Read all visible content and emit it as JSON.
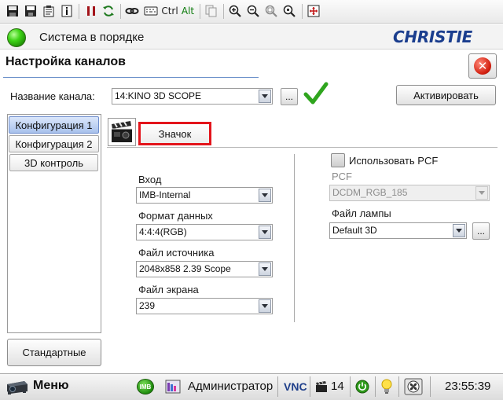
{
  "toolbar": {
    "icons": [
      "save-all-icon",
      "save-icon",
      "properties-icon",
      "info-icon",
      "pause-icon",
      "refresh-icon",
      "link-icon",
      "keyboard-icon",
      "ctrl-key",
      "alt-key",
      "copy-icon",
      "zoom-in-icon",
      "zoom-out-icon",
      "zoom-fit-icon",
      "zoom-reset-icon",
      "fullscreen-icon"
    ],
    "ctrl_label": "Ctrl",
    "alt_label": "Alt"
  },
  "status": {
    "text": "Система в порядке",
    "color": "#3ed416",
    "brand": "CHRISTIE"
  },
  "page": {
    "title": "Настройка каналов",
    "close_icon": "close-icon"
  },
  "channel": {
    "label": "Название канала:",
    "value": "14:KINO 3D SCOPE",
    "dots": "...",
    "activate_label": "Активировать"
  },
  "configs": {
    "items": [
      {
        "label": "Конфигурация 1",
        "active": true
      },
      {
        "label": "Конфигурация 2",
        "active": false
      },
      {
        "label": "3D контроль",
        "active": false
      }
    ],
    "standard_label": "Стандартные"
  },
  "badge": {
    "label": "Значок",
    "highlight_color": "#e3141b"
  },
  "fields": {
    "input_label": "Вход",
    "input_value": "IMB-Internal",
    "format_label": "Формат данных",
    "format_value": "4:4:4(RGB)",
    "source_label": "Файл источника",
    "source_value": "2048x858 2.39 Scope",
    "screen_label": "Файл экрана",
    "screen_value": "239",
    "use_pcf_label": "Использовать PCF",
    "use_pcf_checked": false,
    "pcf_label": "PCF",
    "pcf_value": "DCDM_RGB_185",
    "lamp_label": "Файл лампы",
    "lamp_value": "Default 3D",
    "lamp_dots": "..."
  },
  "taskbar": {
    "menu_label": "Меню",
    "imb_label": "IMB",
    "user_label": "Администратор",
    "vnc_label": "VNC",
    "channel_number": "14",
    "time": "23:55:39"
  }
}
